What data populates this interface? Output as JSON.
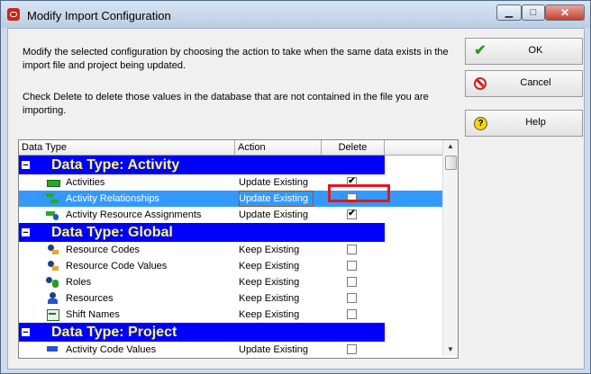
{
  "window": {
    "title": "Modify Import Configuration"
  },
  "description": {
    "line1": "Modify the selected configuration by choosing the action to take when the same data exists in the import file and project being updated.",
    "line2": "Check Delete to delete those values in the database that are not contained in the file you are importing."
  },
  "grid": {
    "columns": [
      "Data Type",
      "Action",
      "Delete"
    ],
    "groups": [
      {
        "label": "Data Type: Activity",
        "toggle": "−"
      },
      {
        "label": "Data Type: Global",
        "toggle": "−"
      },
      {
        "label": "Data Type: Project",
        "toggle": "−"
      }
    ],
    "rows": [
      {
        "name": "Activities",
        "action": "Update Existing",
        "delete": "✔",
        "icon": "activity-bar-icon",
        "selected": false
      },
      {
        "name": "Activity Relationships",
        "action": "Update Existing",
        "delete": "",
        "icon": "relationship-icon",
        "selected": true
      },
      {
        "name": "Activity Resource Assignments",
        "action": "Update Existing",
        "delete": "✔",
        "icon": "resource-assignment-icon",
        "selected": false
      },
      {
        "name": "Resource Codes",
        "action": "Keep Existing",
        "delete": "",
        "icon": "resource-code-icon",
        "selected": false
      },
      {
        "name": "Resource Code Values",
        "action": "Keep Existing",
        "delete": "",
        "icon": "resource-code-value-icon",
        "selected": false
      },
      {
        "name": "Roles",
        "action": "Keep Existing",
        "delete": "",
        "icon": "roles-icon",
        "selected": false
      },
      {
        "name": "Resources",
        "action": "Keep Existing",
        "delete": "",
        "icon": "resource-icon",
        "selected": false
      },
      {
        "name": "Shift Names",
        "action": "Keep Existing",
        "delete": "",
        "icon": "shift-icon",
        "selected": false
      },
      {
        "name": "Activity Code Values",
        "action": "Update Existing",
        "delete": "",
        "icon": "activity-code-icon",
        "selected": false
      }
    ]
  },
  "buttons": {
    "ok": "OK",
    "cancel": "Cancel",
    "help": "Help"
  },
  "window_buttons": {
    "minimize": "▁",
    "maximize": "□",
    "close": "✕"
  },
  "colors": {
    "group_bg": "#0000ff",
    "group_text": "#ffff66",
    "selection": "#3399ff",
    "highlight_box": "#e3161c"
  }
}
